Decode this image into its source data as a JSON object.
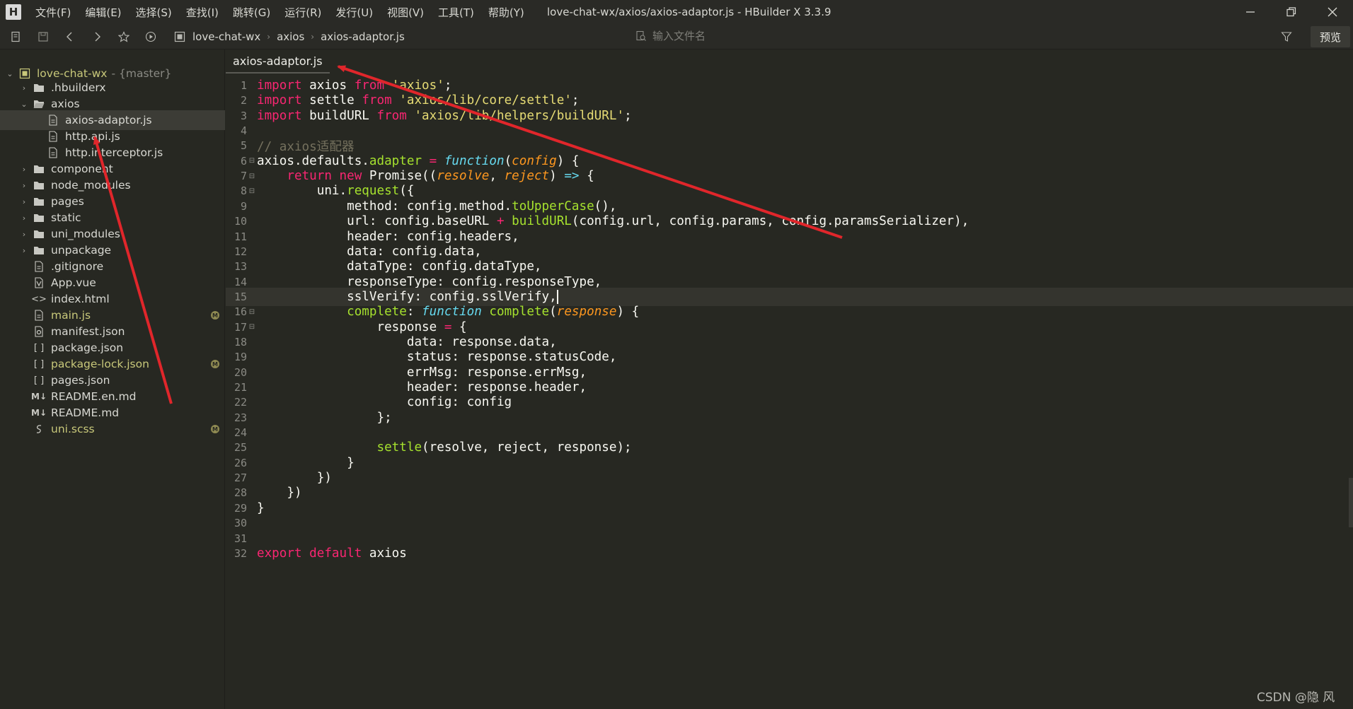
{
  "window": {
    "app_logo": "H",
    "title": "love-chat-wx/axios/axios-adaptor.js - HBuilder X 3.3.9",
    "menu": [
      "文件(F)",
      "编辑(E)",
      "选择(S)",
      "查找(I)",
      "跳转(G)",
      "运行(R)",
      "发行(U)",
      "视图(V)",
      "工具(T)",
      "帮助(Y)"
    ]
  },
  "toolbar": {
    "breadcrumb": [
      "love-chat-wx",
      "axios",
      "axios-adaptor.js"
    ],
    "file_search_placeholder": "输入文件名",
    "preview_label": "预览"
  },
  "sidebar": {
    "root": {
      "name": "love-chat-wx",
      "branch": "- {master}"
    },
    "items": [
      {
        "label": ".hbuilderx",
        "type": "folder",
        "arrow": "›"
      },
      {
        "label": "axios",
        "type": "folder",
        "arrow": "⌄"
      },
      {
        "label": "axios-adaptor.js",
        "type": "file"
      },
      {
        "label": "http.api.js",
        "type": "file"
      },
      {
        "label": "http.interceptor.js",
        "type": "file"
      },
      {
        "label": "component",
        "type": "folder",
        "arrow": "›"
      },
      {
        "label": "node_modules",
        "type": "folder",
        "arrow": "›"
      },
      {
        "label": "pages",
        "type": "folder",
        "arrow": "›"
      },
      {
        "label": "static",
        "type": "folder",
        "arrow": "›"
      },
      {
        "label": "uni_modules",
        "type": "folder",
        "arrow": "›"
      },
      {
        "label": "unpackage",
        "type": "folder",
        "arrow": "›"
      },
      {
        "label": ".gitignore",
        "type": "file"
      },
      {
        "label": "App.vue",
        "type": "vue"
      },
      {
        "label": "index.html",
        "type": "html"
      },
      {
        "label": "main.js",
        "type": "file",
        "modified": true
      },
      {
        "label": "manifest.json",
        "type": "manifest"
      },
      {
        "label": "package.json",
        "type": "json"
      },
      {
        "label": "package-lock.json",
        "type": "json",
        "modified": true
      },
      {
        "label": "pages.json",
        "type": "json"
      },
      {
        "label": "README.en.md",
        "type": "md"
      },
      {
        "label": "README.md",
        "type": "md"
      },
      {
        "label": "uni.scss",
        "type": "scss",
        "modified": true
      }
    ],
    "modified_badge": "M",
    "json_icon": "[ ]",
    "md_icon": "M↓",
    "html_icon": "<>"
  },
  "editor": {
    "tab_label": "axios-adaptor.js",
    "current_line": 15,
    "lines": [
      "1",
      "2",
      "3",
      "4",
      "5",
      "6",
      "7",
      "8",
      "9",
      "10",
      "11",
      "12",
      "13",
      "14",
      "15",
      "16",
      "17",
      "18",
      "19",
      "20",
      "21",
      "22",
      "23",
      "24",
      "25",
      "26",
      "27",
      "28",
      "29",
      "30",
      "31",
      "32"
    ],
    "code": {
      "l1": [
        "import",
        " axios ",
        "from",
        " ",
        "'axios'",
        ";"
      ],
      "l2": [
        "import",
        " settle ",
        "from",
        " ",
        "'axios/lib/core/settle'",
        ";"
      ],
      "l3": [
        "import",
        " buildURL ",
        "from",
        " ",
        "'axios/lib/helpers/buildURL'",
        ";"
      ],
      "l5": "// axios适配器",
      "l6": [
        "axios.defaults.",
        "adapter",
        " ",
        "=",
        " ",
        "function",
        "(",
        "config",
        ") {"
      ],
      "l7": [
        "    ",
        "return",
        " ",
        "new",
        " Promise((",
        "resolve",
        ", ",
        "reject",
        ") ",
        "=>",
        " {"
      ],
      "l8": [
        "        uni.",
        "request",
        "({"
      ],
      "l9": [
        "            method: config.method.",
        "toUpperCase",
        "(),"
      ],
      "l10": [
        "            url: config.baseURL ",
        "+",
        " ",
        "buildURL",
        "(config.url, config.params, config.paramsSerializer),"
      ],
      "l11": "            header: config.headers,",
      "l12": "            data: config.data,",
      "l13": "            dataType: config.dataType,",
      "l14": "            responseType: config.responseType,",
      "l15": "            sslVerify: config.sslVerify,",
      "l16": [
        "            ",
        "complete",
        ": ",
        "function",
        " ",
        "complete",
        "(",
        "response",
        ") {"
      ],
      "l17": [
        "                response ",
        "=",
        " {"
      ],
      "l18": "                    data: response.data,",
      "l19": "                    status: response.statusCode,",
      "l20": "                    errMsg: response.errMsg,",
      "l21": "                    header: response.header,",
      "l22": "                    config: config",
      "l23": "                };",
      "l25": [
        "                ",
        "settle",
        "(resolve, reject, response);"
      ],
      "l26": "            }",
      "l27": "        })",
      "l28": "    })",
      "l29": "}",
      "l32": [
        "export",
        " ",
        "default",
        " axios"
      ]
    }
  },
  "watermark": "CSDN @隐 风",
  "colors": {
    "background": "#272822",
    "keyword": "#f92672",
    "string": "#e6db74",
    "function": "#a6e22e",
    "storage": "#66d9ef",
    "parameter": "#fd971f",
    "comment": "#75715e",
    "annotation_arrow": "#e0262b"
  }
}
